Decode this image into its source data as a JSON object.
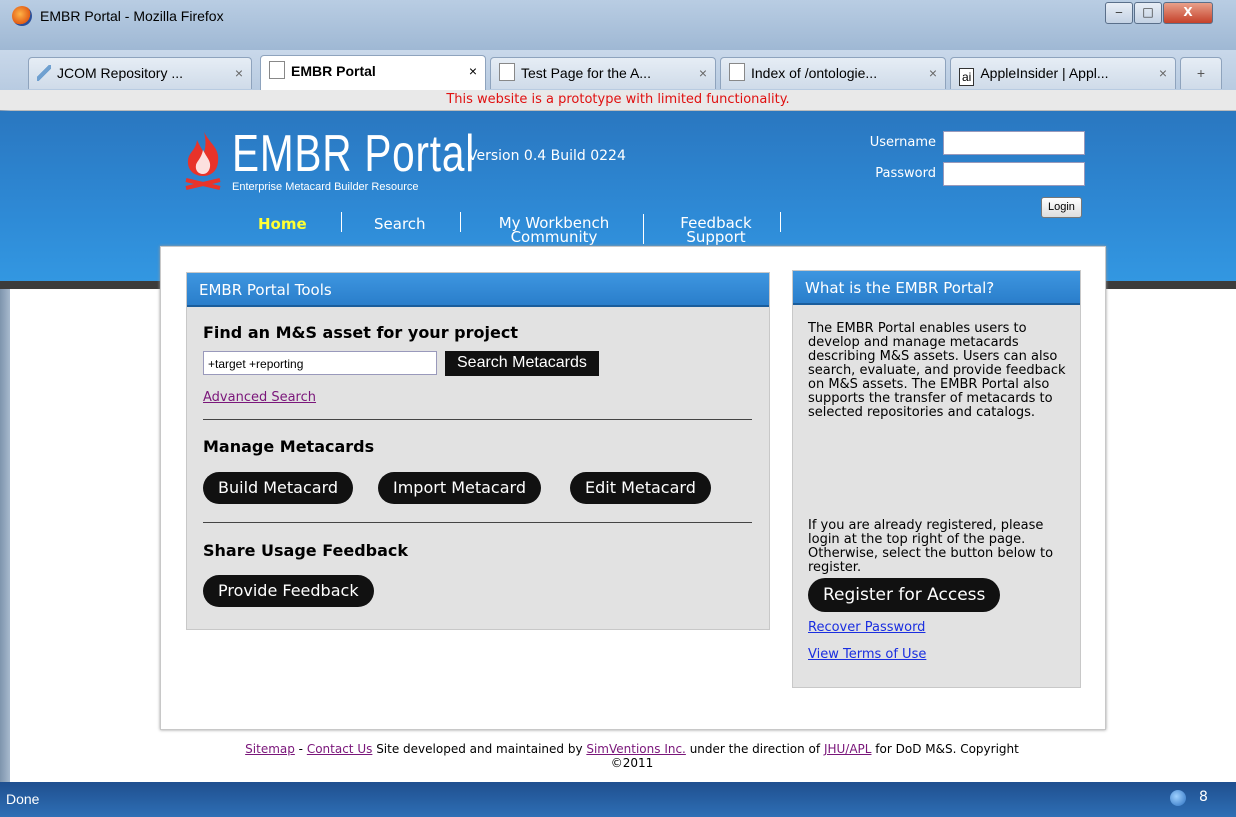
{
  "window": {
    "title": "EMBR Portal - Mozilla Firefox",
    "controls": {
      "minimize": "‒",
      "maximize": "□",
      "close": "X"
    }
  },
  "tabs": [
    {
      "label": "JCOM Repository ...",
      "close": "×"
    },
    {
      "label": "EMBR Portal",
      "close": "×"
    },
    {
      "label": "Test Page for the A...",
      "close": "×"
    },
    {
      "label": "Index of /ontologie...",
      "close": "×"
    },
    {
      "label": "AppleInsider | Appl...",
      "close": "×",
      "icon_text": "ai"
    }
  ],
  "new_tab": "+",
  "prototype_notice": "This website is a prototype with limited functionality.",
  "header": {
    "logo_title": "EMBR Portal",
    "logo_subtitle": "Enterprise Metacard Builder Resource",
    "version": "Version 0.4 Build 0224",
    "username_label": "Username",
    "password_label": "Password",
    "login_button": "Login"
  },
  "nav": {
    "home": "Home",
    "search": "Search",
    "workbench_line1": "My Workbench",
    "workbench_line2": "Community",
    "feedback_line1": "Feedback",
    "feedback_line2": "Support"
  },
  "tools": {
    "panel_title": "EMBR Portal Tools",
    "find_heading": "Find an M&S asset for your project",
    "search_value": "+target +reporting",
    "search_button": "Search Metacards",
    "advanced_search": "Advanced Search",
    "manage_heading": "Manage Metacards",
    "build_button": "Build Metacard",
    "import_button": "Import Metacard",
    "edit_button": "Edit Metacard",
    "share_heading": "Share Usage Feedback",
    "feedback_button": "Provide Feedback"
  },
  "about": {
    "panel_title": "What is the EMBR Portal?",
    "paragraph1": "The EMBR Portal enables users to develop and manage metacards describing M&S assets. Users can also search, evaluate, and provide feedback on M&S assets. The EMBR Portal also supports the transfer of metacards to selected repositories and catalogs.",
    "paragraph2": "If you are already registered, please login at the top right of the page. Otherwise, select the button below to register.",
    "register_button": "Register for Access",
    "recover_password": "Recover Password",
    "terms": "View Terms of Use"
  },
  "footer": {
    "sitemap": "Sitemap",
    "dash": " - ",
    "contact": "Contact Us",
    "text1": " Site developed and maintained by ",
    "simventions": "SimVentions Inc.",
    "text2": " under the direction of ",
    "jhuapl": "JHU/APL",
    "text3": " for DoD M&S. Copyright",
    "copyright": "©2011"
  },
  "status": {
    "text": "Done",
    "tray_count": "8"
  },
  "colors": {
    "header_blue": "#2e8ad6",
    "notice_red": "#e01010",
    "nav_active": "#ffff33",
    "link_purple": "#7a167a"
  }
}
